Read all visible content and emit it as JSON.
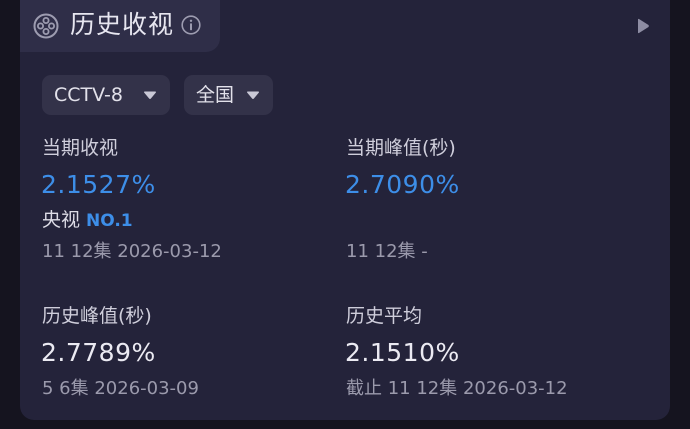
{
  "header": {
    "title": "历史收视",
    "logo_icon": "film-reel-icon",
    "info_icon": "info-icon",
    "play_icon": "play-icon"
  },
  "filters": {
    "channel": "CCTV-8",
    "region": "全国"
  },
  "stats": {
    "current_rating": {
      "label": "当期收视",
      "value": "2.1527%",
      "rank_prefix": "央视",
      "rank": "NO.1",
      "detail": "11 12集  2026-03-12"
    },
    "current_peak": {
      "label": "当期峰值(秒)",
      "value": "2.7090%",
      "detail": "11 12集  -"
    },
    "history_peak": {
      "label": "历史峰值(秒)",
      "value": "2.7789%",
      "detail": "5 6集  2026-03-09"
    },
    "history_average": {
      "label": "历史平均",
      "value": "2.1510%",
      "detail": "截止 11 12集  2026-03-12"
    }
  },
  "colors": {
    "background": "#15141f",
    "card": "#24233a",
    "accent_blue": "#3d8ee8",
    "text_primary": "#ebeaf2",
    "text_secondary": "#9b9aac"
  }
}
